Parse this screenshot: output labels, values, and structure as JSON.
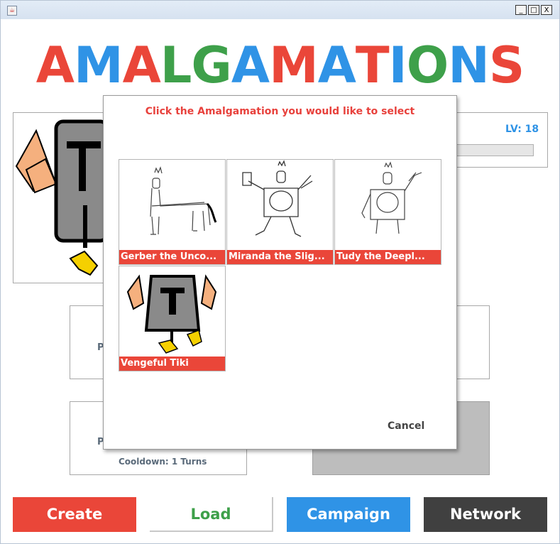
{
  "window": {
    "app_icon": "java-cup-icon",
    "controls": {
      "minimize": "_",
      "maximize": "□",
      "close": "X"
    }
  },
  "logo": {
    "letters": [
      {
        "ch": "A",
        "color": "#ea4639"
      },
      {
        "ch": "M",
        "color": "#2f93e6"
      },
      {
        "ch": "A",
        "color": "#ea4639"
      },
      {
        "ch": "L",
        "color": "#3ea04a"
      },
      {
        "ch": "G",
        "color": "#3ea04a"
      },
      {
        "ch": "A",
        "color": "#2f93e6"
      },
      {
        "ch": "M",
        "color": "#ea4639"
      },
      {
        "ch": "A",
        "color": "#2f93e6"
      },
      {
        "ch": "T",
        "color": "#ea4639"
      },
      {
        "ch": "I",
        "color": "#2f93e6"
      },
      {
        "ch": "O",
        "color": "#3ea04a"
      },
      {
        "ch": "N",
        "color": "#2f93e6"
      },
      {
        "ch": "S",
        "color": "#ea4639"
      }
    ]
  },
  "status": {
    "level": "LV: 18"
  },
  "background_panels": {
    "left_peek_1": "P",
    "left_peek_2": "P",
    "cooldown": "Cooldown: 1 Turns"
  },
  "dialog": {
    "title": "Click the Amalgamation you would like to select",
    "cards": [
      {
        "label": "Gerber the Unco...",
        "image": "sketch-centaur"
      },
      {
        "label": "Miranda the Slig...",
        "image": "sketch-armored-figure"
      },
      {
        "label": "Tudy the Deepl...",
        "image": "sketch-armored-figure-2"
      },
      {
        "label": "Vengeful Tiki",
        "image": "tiki-mask"
      }
    ],
    "cancel": "Cancel"
  },
  "bottom_buttons": [
    {
      "label": "Create",
      "color": "#ea4639"
    },
    {
      "label": "Load",
      "color": "#3ea04a"
    },
    {
      "label": "Campaign",
      "color": "#2f93e6"
    },
    {
      "label": "Network",
      "color": "#404040"
    }
  ]
}
